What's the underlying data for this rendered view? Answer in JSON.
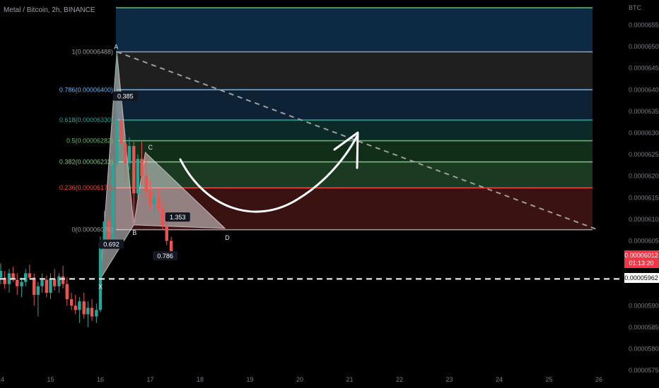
{
  "symbol_title": "Metal / Bitcoin, 2h, BINANCE",
  "chart_data": {
    "type": "candlestick",
    "title": "Metal / Bitcoin, 2h, BINANCE",
    "currency": "BTC",
    "ylim": [
      5.74e-05,
      6.6e-05
    ],
    "y_ticks": [
      "0.00006550",
      "0.00006500",
      "0.00006450",
      "0.00006400",
      "0.00006350",
      "0.00006300",
      "0.00006250",
      "0.00006200",
      "0.00006150",
      "0.00006100",
      "0.00006050",
      "0.00005900",
      "0.00005850",
      "0.00005800",
      "0.00005750"
    ],
    "x_ticks": [
      "14",
      "15",
      "16",
      "17",
      "18",
      "19",
      "20",
      "21",
      "22",
      "23",
      "24",
      "25",
      "26"
    ],
    "last_price": "0.00006012",
    "countdown": "01:13:20",
    "reference_line": "0.00005962",
    "fib_levels": [
      {
        "ratio": 1,
        "label": "1(0.00006488)",
        "price": 6.488e-05,
        "color": "#9e9e9e"
      },
      {
        "ratio": 0.786,
        "label": "0.786(0.00006400)",
        "price": 6.4e-05,
        "color": "#64b5f6"
      },
      {
        "ratio": 0.618,
        "label": "0.618(0.00006330)",
        "price": 6.33e-05,
        "color": "#26a69a"
      },
      {
        "ratio": 0.5,
        "label": "0.5(0.00006282)",
        "price": 6.282e-05,
        "color": "#66bb6a"
      },
      {
        "ratio": 0.382,
        "label": "0.382(0.00006233)",
        "price": 6.233e-05,
        "color": "#81c784"
      },
      {
        "ratio": 0.236,
        "label": "0.236(0.00006173)",
        "price": 6.173e-05,
        "color": "#f44336"
      },
      {
        "ratio": 0,
        "label": "0(0.00006076)",
        "price": 6.076e-05,
        "color": "#9e9e9e"
      }
    ],
    "fib_extra_level": {
      "price": 6.59e-05,
      "color": "#66bb6a"
    },
    "pattern_points": [
      {
        "name": "X",
        "day": 16.0,
        "price": 5.962e-05
      },
      {
        "name": "A",
        "day": 16.33,
        "price": 6.488e-05
      },
      {
        "name": "B",
        "day": 16.67,
        "price": 6.087e-05
      },
      {
        "name": "C",
        "day": 16.9,
        "price": 6.255e-05
      },
      {
        "name": "D",
        "day": 18.5,
        "price": 6.079e-05
      }
    ],
    "pattern_ratios": [
      {
        "label": "0.385",
        "day": 16.5,
        "price": 6.383e-05
      },
      {
        "label": "0.692",
        "day": 16.22,
        "price": 6.04e-05
      },
      {
        "label": "1.353",
        "day": 17.55,
        "price": 6.103e-05
      },
      {
        "label": "0.786",
        "day": 17.3,
        "price": 6.013e-05
      }
    ],
    "diagonal_trendline": {
      "from": {
        "day": 16.33,
        "price": 6.488e-05
      },
      "to": {
        "day": 26.0,
        "price": 6.075e-05
      }
    },
    "candles": [
      {
        "day": 14.0,
        "o": 5.975e-05,
        "h": 5.998e-05,
        "l": 5.95e-05,
        "c": 5.965e-05
      },
      {
        "day": 14.08,
        "o": 5.965e-05,
        "h": 5.98e-05,
        "l": 5.94e-05,
        "c": 5.95e-05
      },
      {
        "day": 14.17,
        "o": 5.95e-05,
        "h": 5.985e-05,
        "l": 5.93e-05,
        "c": 5.975e-05
      },
      {
        "day": 14.25,
        "o": 5.975e-05,
        "h": 5.99e-05,
        "l": 5.955e-05,
        "c": 5.96e-05
      },
      {
        "day": 14.33,
        "o": 5.96e-05,
        "h": 5.975e-05,
        "l": 5.925e-05,
        "c": 5.945e-05
      },
      {
        "day": 14.42,
        "o": 5.945e-05,
        "h": 5.965e-05,
        "l": 5.92e-05,
        "c": 5.955e-05
      },
      {
        "day": 14.5,
        "o": 5.955e-05,
        "h": 5.985e-05,
        "l": 5.945e-05,
        "c": 5.975e-05
      },
      {
        "day": 14.58,
        "o": 5.975e-05,
        "h": 5.995e-05,
        "l": 5.96e-05,
        "c": 5.965e-05
      },
      {
        "day": 14.67,
        "o": 5.965e-05,
        "h": 5.975e-05,
        "l": 5.9e-05,
        "c": 5.925e-05
      },
      {
        "day": 14.75,
        "o": 5.925e-05,
        "h": 5.955e-05,
        "l": 5.875e-05,
        "c": 5.945e-05
      },
      {
        "day": 14.83,
        "o": 5.945e-05,
        "h": 5.975e-05,
        "l": 5.93e-05,
        "c": 5.96e-05
      },
      {
        "day": 14.92,
        "o": 5.96e-05,
        "h": 5.97e-05,
        "l": 5.92e-05,
        "c": 5.93e-05
      },
      {
        "day": 15.0,
        "o": 5.93e-05,
        "h": 5.975e-05,
        "l": 5.915e-05,
        "c": 5.962e-05
      },
      {
        "day": 15.08,
        "o": 5.962e-05,
        "h": 5.985e-05,
        "l": 5.935e-05,
        "c": 5.945e-05
      },
      {
        "day": 15.17,
        "o": 5.945e-05,
        "h": 5.975e-05,
        "l": 5.93e-05,
        "c": 5.968e-05
      },
      {
        "day": 15.25,
        "o": 5.968e-05,
        "h": 5.992e-05,
        "l": 5.94e-05,
        "c": 5.95e-05
      },
      {
        "day": 15.33,
        "o": 5.95e-05,
        "h": 5.965e-05,
        "l": 5.9e-05,
        "c": 5.915e-05
      },
      {
        "day": 15.42,
        "o": 5.915e-05,
        "h": 5.93e-05,
        "l": 5.89e-05,
        "c": 5.9e-05
      },
      {
        "day": 15.5,
        "o": 5.9e-05,
        "h": 5.925e-05,
        "l": 5.88e-05,
        "c": 5.89e-05
      },
      {
        "day": 15.58,
        "o": 5.89e-05,
        "h": 5.92e-05,
        "l": 5.86e-05,
        "c": 5.91e-05
      },
      {
        "day": 15.67,
        "o": 5.91e-05,
        "h": 5.93e-05,
        "l": 5.87e-05,
        "c": 5.88e-05
      },
      {
        "day": 15.75,
        "o": 5.88e-05,
        "h": 5.91e-05,
        "l": 5.85e-05,
        "c": 5.895e-05
      },
      {
        "day": 15.83,
        "o": 5.895e-05,
        "h": 5.915e-05,
        "l": 5.865e-05,
        "c": 5.875e-05
      },
      {
        "day": 15.92,
        "o": 5.875e-05,
        "h": 5.905e-05,
        "l": 5.86e-05,
        "c": 5.89e-05
      },
      {
        "day": 16.0,
        "o": 5.89e-05,
        "h": 6.06e-05,
        "l": 5.885e-05,
        "c": 6.045e-05
      },
      {
        "day": 16.08,
        "o": 6.045e-05,
        "h": 6.12e-05,
        "l": 6.01e-05,
        "c": 6.095e-05
      },
      {
        "day": 16.17,
        "o": 6.095e-05,
        "h": 6.105e-05,
        "l": 6.03e-05,
        "c": 6.055e-05
      },
      {
        "day": 16.25,
        "o": 6.055e-05,
        "h": 6.25e-05,
        "l": 6.04e-05,
        "c": 6.23e-05
      },
      {
        "day": 16.33,
        "o": 6.23e-05,
        "h": 6.488e-05,
        "l": 6.22e-05,
        "c": 6.33e-05
      },
      {
        "day": 16.42,
        "o": 6.33e-05,
        "h": 6.39e-05,
        "l": 6.255e-05,
        "c": 6.275e-05
      },
      {
        "day": 16.5,
        "o": 6.275e-05,
        "h": 6.295e-05,
        "l": 6.195e-05,
        "c": 6.23e-05
      },
      {
        "day": 16.58,
        "o": 6.23e-05,
        "h": 6.29e-05,
        "l": 6.215e-05,
        "c": 6.27e-05
      },
      {
        "day": 16.67,
        "o": 6.27e-05,
        "h": 6.28e-05,
        "l": 6.087e-05,
        "c": 6.16e-05
      },
      {
        "day": 16.75,
        "o": 6.16e-05,
        "h": 6.25e-05,
        "l": 6.15e-05,
        "c": 6.24e-05
      },
      {
        "day": 16.83,
        "o": 6.24e-05,
        "h": 6.28e-05,
        "l": 6.18e-05,
        "c": 6.2e-05
      },
      {
        "day": 16.92,
        "o": 6.2e-05,
        "h": 6.255e-05,
        "l": 6.15e-05,
        "c": 6.165e-05
      },
      {
        "day": 17.0,
        "o": 6.165e-05,
        "h": 6.19e-05,
        "l": 6.12e-05,
        "c": 6.135e-05
      },
      {
        "day": 17.08,
        "o": 6.135e-05,
        "h": 6.16e-05,
        "l": 6.11e-05,
        "c": 6.15e-05
      },
      {
        "day": 17.17,
        "o": 6.15e-05,
        "h": 6.17e-05,
        "l": 6.115e-05,
        "c": 6.125e-05
      },
      {
        "day": 17.25,
        "o": 6.125e-05,
        "h": 6.14e-05,
        "l": 6.075e-05,
        "c": 6.085e-05
      },
      {
        "day": 17.33,
        "o": 6.085e-05,
        "h": 6.1e-05,
        "l": 6.04e-05,
        "c": 6.05e-05
      },
      {
        "day": 17.42,
        "o": 6.05e-05,
        "h": 6.06e-05,
        "l": 6.005e-05,
        "c": 6.012e-05
      }
    ]
  }
}
